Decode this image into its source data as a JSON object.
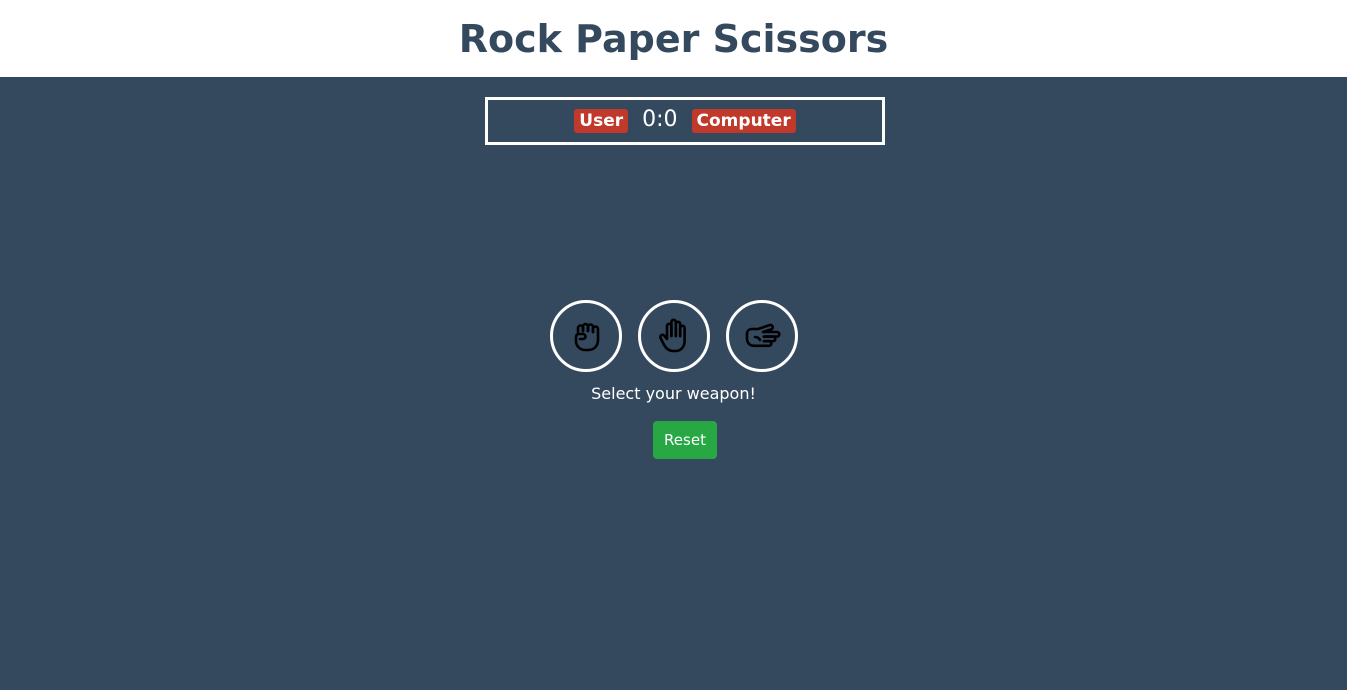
{
  "header": {
    "title": "Rock Paper Scissors"
  },
  "scoreboard": {
    "user_label": "User",
    "score": "0:0",
    "computer_label": "Computer"
  },
  "choices": [
    {
      "name": "rock",
      "icon": "fist-icon"
    },
    {
      "name": "paper",
      "icon": "open-hand-icon"
    },
    {
      "name": "scissors",
      "icon": "scissors-hand-icon"
    }
  ],
  "message": "Select your weapon!",
  "reset_label": "Reset",
  "colors": {
    "background": "#34495e",
    "header_bg": "#ffffff",
    "title": "#34495e",
    "badge": "#c0392b",
    "reset_button": "#28a745"
  }
}
